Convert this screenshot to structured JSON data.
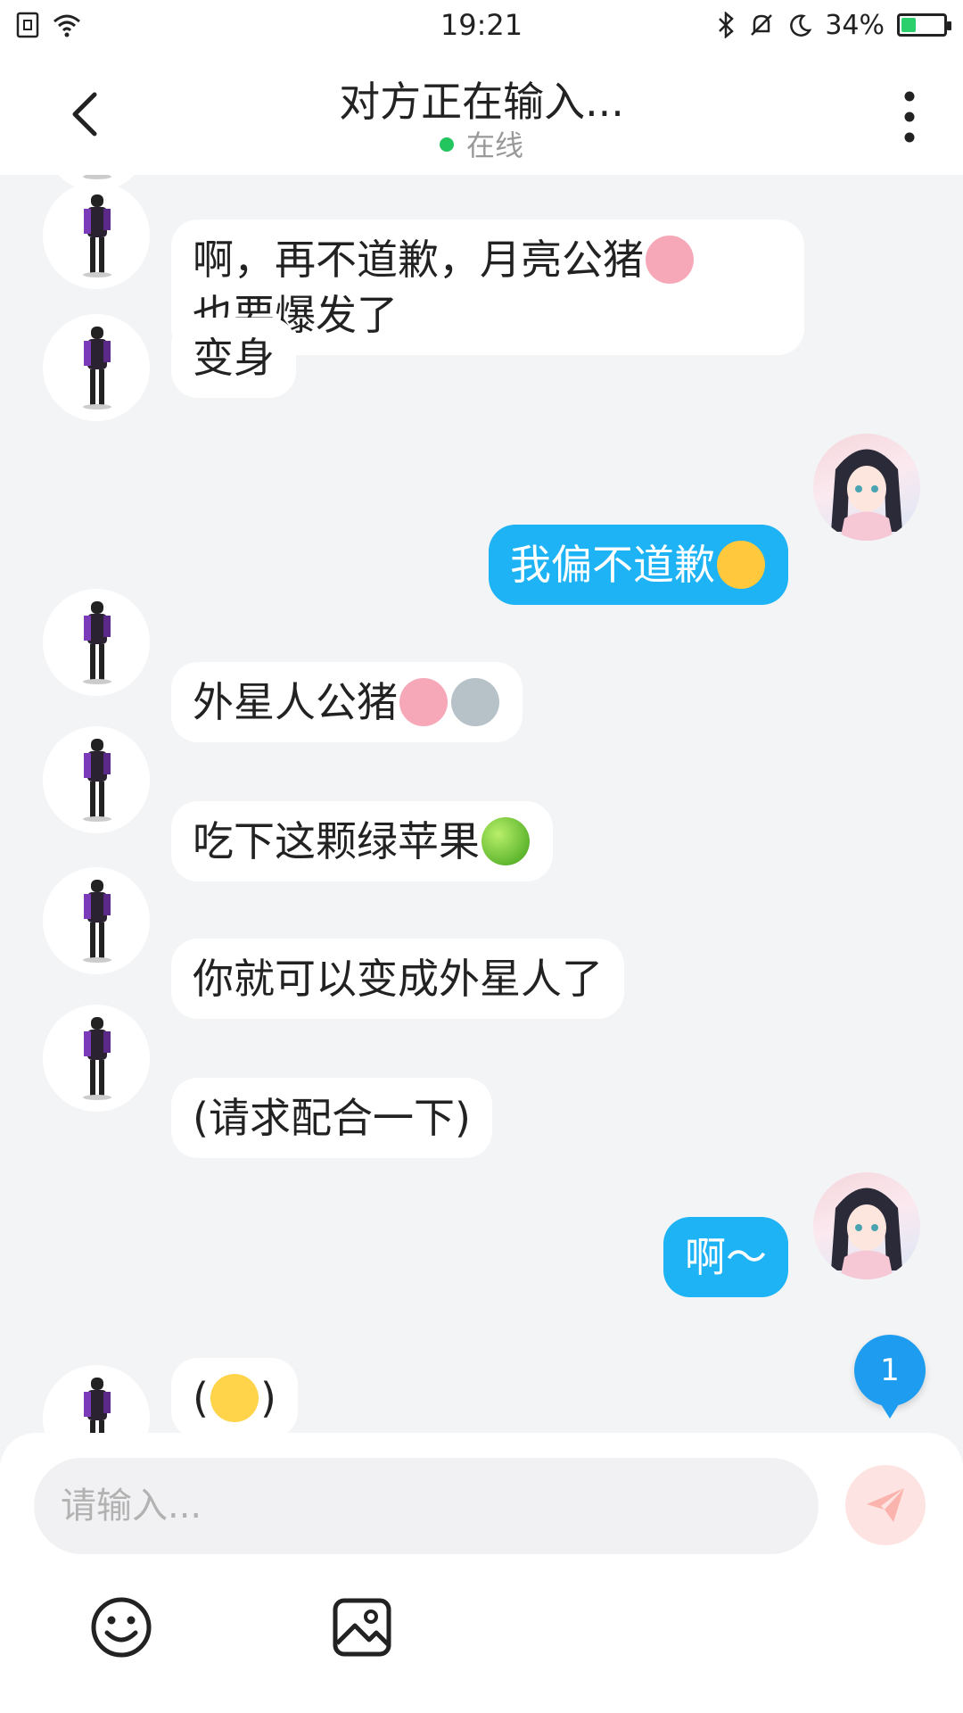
{
  "status_bar": {
    "time": "19:21",
    "battery_percent": "34%",
    "battery_level": 0.34,
    "accent": "#2bcf6b"
  },
  "header": {
    "title": "对方正在输入...",
    "status": "在线",
    "status_color": "#22c55e"
  },
  "messages": [
    {
      "side": "left",
      "text": "啊，再不道歉，月亮公猪",
      "text2": "也要爆发了",
      "emojis": [
        "pig"
      ]
    },
    {
      "side": "left",
      "text": "变身"
    },
    {
      "side": "right",
      "text": "我偏不道歉",
      "emojis": [
        "wink-tongue"
      ]
    },
    {
      "side": "left",
      "text": "外星人公猪",
      "emojis": [
        "pig",
        "alien"
      ]
    },
    {
      "side": "left",
      "text": "吃下这颗绿苹果",
      "emojis": [
        "green-apple"
      ]
    },
    {
      "side": "left",
      "text": "你就可以变成外星人了"
    },
    {
      "side": "left",
      "text": "(请求配合一下)"
    },
    {
      "side": "right",
      "text": "啊～"
    },
    {
      "side": "left",
      "text_before": "(",
      "text_after": ")",
      "emojis": [
        "no-mouth"
      ]
    }
  ],
  "unread_badge": "1",
  "composer": {
    "placeholder": "请输入..."
  },
  "colors": {
    "right_bubble": "#1eb3f5",
    "left_bubble": "#ffffff",
    "background": "#f3f4f6"
  }
}
